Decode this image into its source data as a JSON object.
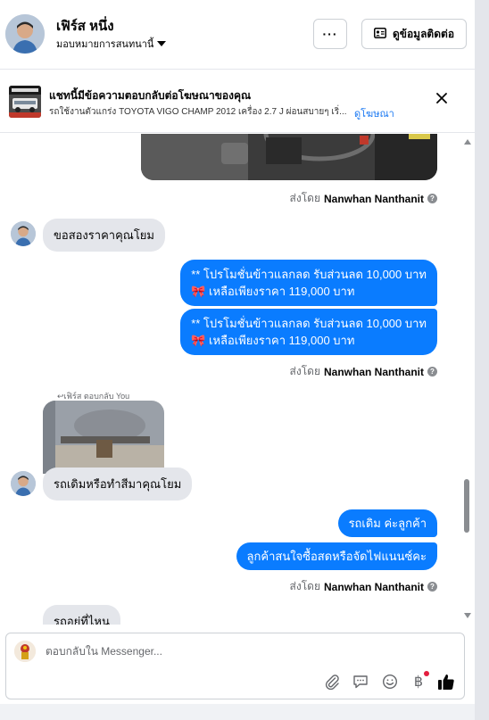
{
  "header": {
    "contact_name": "เฟิร์ส หนึ่ง",
    "assign_label": "มอบหมายการสนทนานี้",
    "more_label": "···",
    "view_contact_label": "ดูข้อมูลติดต่อ"
  },
  "ad_banner": {
    "title": "แชทนี้มีข้อความตอบกลับต่อโฆษณาของคุณ",
    "subtitle": "รถใช้งานตัวแกร่ง TOYOTA VIGO CHAMP 2012 เครื่อง 2.7 J ผ่อนสบายๆ เริ่...",
    "link_label": "ดูโฆษณา"
  },
  "messages": {
    "sent_by_prefix": "ส่งโดย",
    "sender_name": "Nanwhan Nanthanit",
    "incoming_1": "ขอสองราคาคุณโยม",
    "promo_line1": "** โปรโมชั่นข้าวแลกลด รับส่วนลด 10,000 บาท",
    "promo_line2": "เหลือเพียงราคา 119,000 บาท",
    "reply_label": "เฟิร์ส ตอบกลับ You",
    "incoming_2": "รถเดิมหรือทำสีมาคุณโยม",
    "outgoing_1": "รถเดิม ค่ะลูกค้า",
    "outgoing_2": "ลูกค้าสนใจซื้อสดหรือจัดไฟแนนซ์คะ",
    "incoming_3": "รถอยู่ที่ไหน"
  },
  "composer": {
    "placeholder": "ตอบกลับใน Messenger..."
  },
  "icons": {
    "attach": "paperclip-icon",
    "saved_replies": "chat-bubble-icon",
    "emoji": "smiley-icon",
    "payment": "baht-icon",
    "like": "thumbs-up-icon"
  },
  "colors": {
    "accent": "#0a7cff",
    "incoming_bubble": "#e4e6eb",
    "link": "#1877f2",
    "notification": "#e41e3f"
  }
}
